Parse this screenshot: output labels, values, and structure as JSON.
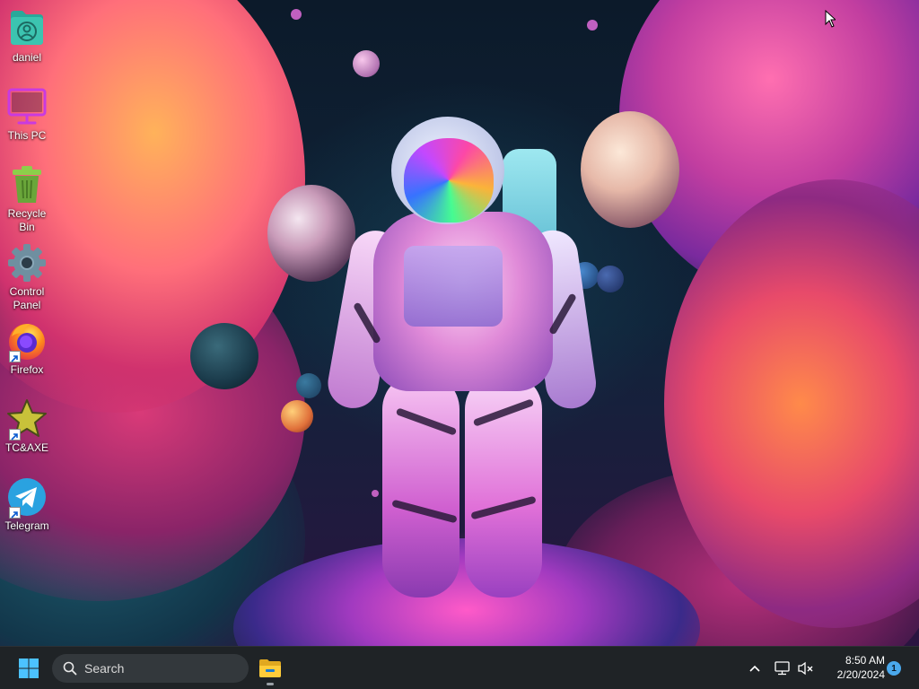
{
  "desktop": {
    "icons": [
      {
        "label": "daniel",
        "icon": "user-folder-icon"
      },
      {
        "label": "This PC",
        "icon": "monitor-icon"
      },
      {
        "label": "Recycle Bin",
        "icon": "recycle-bin-icon"
      },
      {
        "label": "Control Panel",
        "icon": "gear-icon"
      },
      {
        "label": "Firefox",
        "icon": "firefox-icon"
      },
      {
        "label": "TC&AXE",
        "icon": "star-icon"
      },
      {
        "label": "Telegram",
        "icon": "telegram-icon"
      }
    ]
  },
  "taskbar": {
    "start_icon": "windows-logo-icon",
    "search": {
      "label": "Search",
      "icon": "search-icon"
    },
    "pinned": [
      {
        "name": "File Explorer",
        "icon": "folder-icon"
      }
    ],
    "tray": {
      "chevron_icon": "chevron-up-icon",
      "network_icon": "network-icon",
      "volume_icon": "volume-muted-icon",
      "time": "8:50 AM",
      "date": "2/20/2024",
      "notification_count": "1"
    }
  },
  "colors": {
    "taskbar_bg": "#1f2326",
    "search_bg": "#33383c",
    "accent": "#4aa8ec"
  }
}
